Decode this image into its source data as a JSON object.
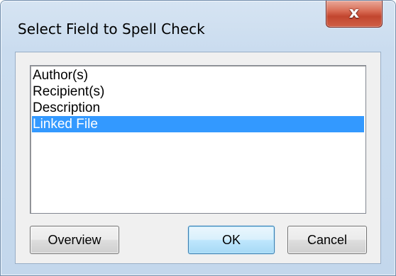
{
  "window": {
    "title": "Select Field to Spell Check",
    "close_glyph": "x"
  },
  "listbox": {
    "items": [
      {
        "label": "Author(s)",
        "selected": false
      },
      {
        "label": "Recipient(s)",
        "selected": false
      },
      {
        "label": "Description",
        "selected": false
      },
      {
        "label": "Linked File",
        "selected": true
      }
    ]
  },
  "buttons": {
    "overview_label": "Overview",
    "ok_label": "OK",
    "cancel_label": "Cancel"
  },
  "colors": {
    "selection": "#3399ff",
    "close_button": "#c2462f",
    "default_button": "#3c7fb1"
  }
}
